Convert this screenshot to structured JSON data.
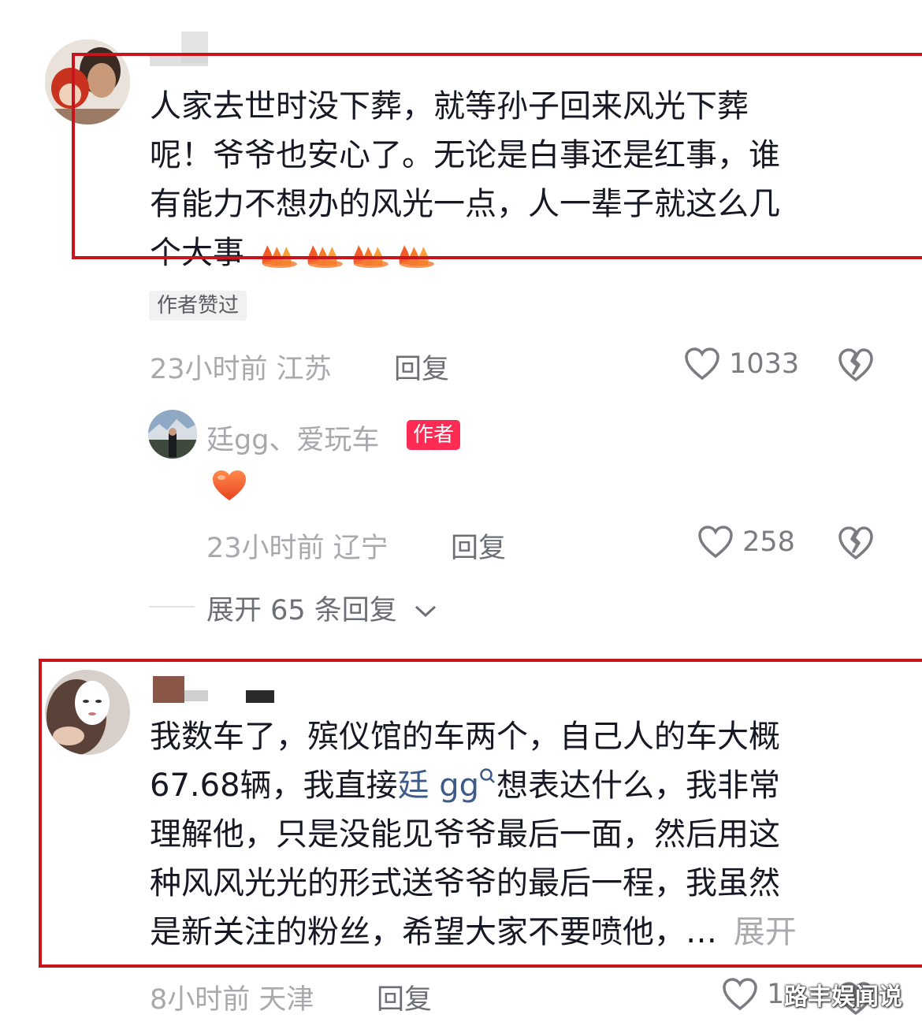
{
  "comment1": {
    "username": "",
    "lines": [
      "人家去世时没下葬，就等孙子回来风光下葬",
      "呢！爷爷也安心了。无论是白事还是红事，谁",
      "有能力不想办的风光一点，人一辈子就这么几",
      "个大事"
    ],
    "flame_count": 4,
    "author_liked_badge": "作者赞过",
    "time_location": "23小时前 江苏",
    "reply_label": "回复",
    "like_count": "1033"
  },
  "reply1": {
    "username": "廷gg、爱玩车",
    "author_tag": "作者",
    "emoji": "heart",
    "time_location": "23小时前 辽宁",
    "reply_label": "回复",
    "like_count": "258"
  },
  "expand_replies": "展开 65 条回复",
  "comment2": {
    "username": "",
    "line1": "我数车了，殡仪馆的车两个，自己人的车大概",
    "line2_prefix": "67.68辆，我直接",
    "line2_mention": "廷 gg",
    "line2_suffix": "想表达什么，我非常",
    "line3": "理解他，只是没能见爷爷最后一面，然后用这",
    "line4": "种风风光光的形式送爷爷的最后一程，我虽然",
    "line5": "是新关注的粉丝，希望大家不要喷他，…",
    "expand_label": "展开",
    "time_location": "8小时前 天津",
    "reply_label": "回复",
    "like_count": "1"
  },
  "watermark": "路丰娱闻说",
  "colors": {
    "highlight_box": "#c8151d",
    "author_tag_bg": "#fe2c55",
    "heart_emoji": "#f05a28",
    "mention": "#3d5a8a"
  }
}
